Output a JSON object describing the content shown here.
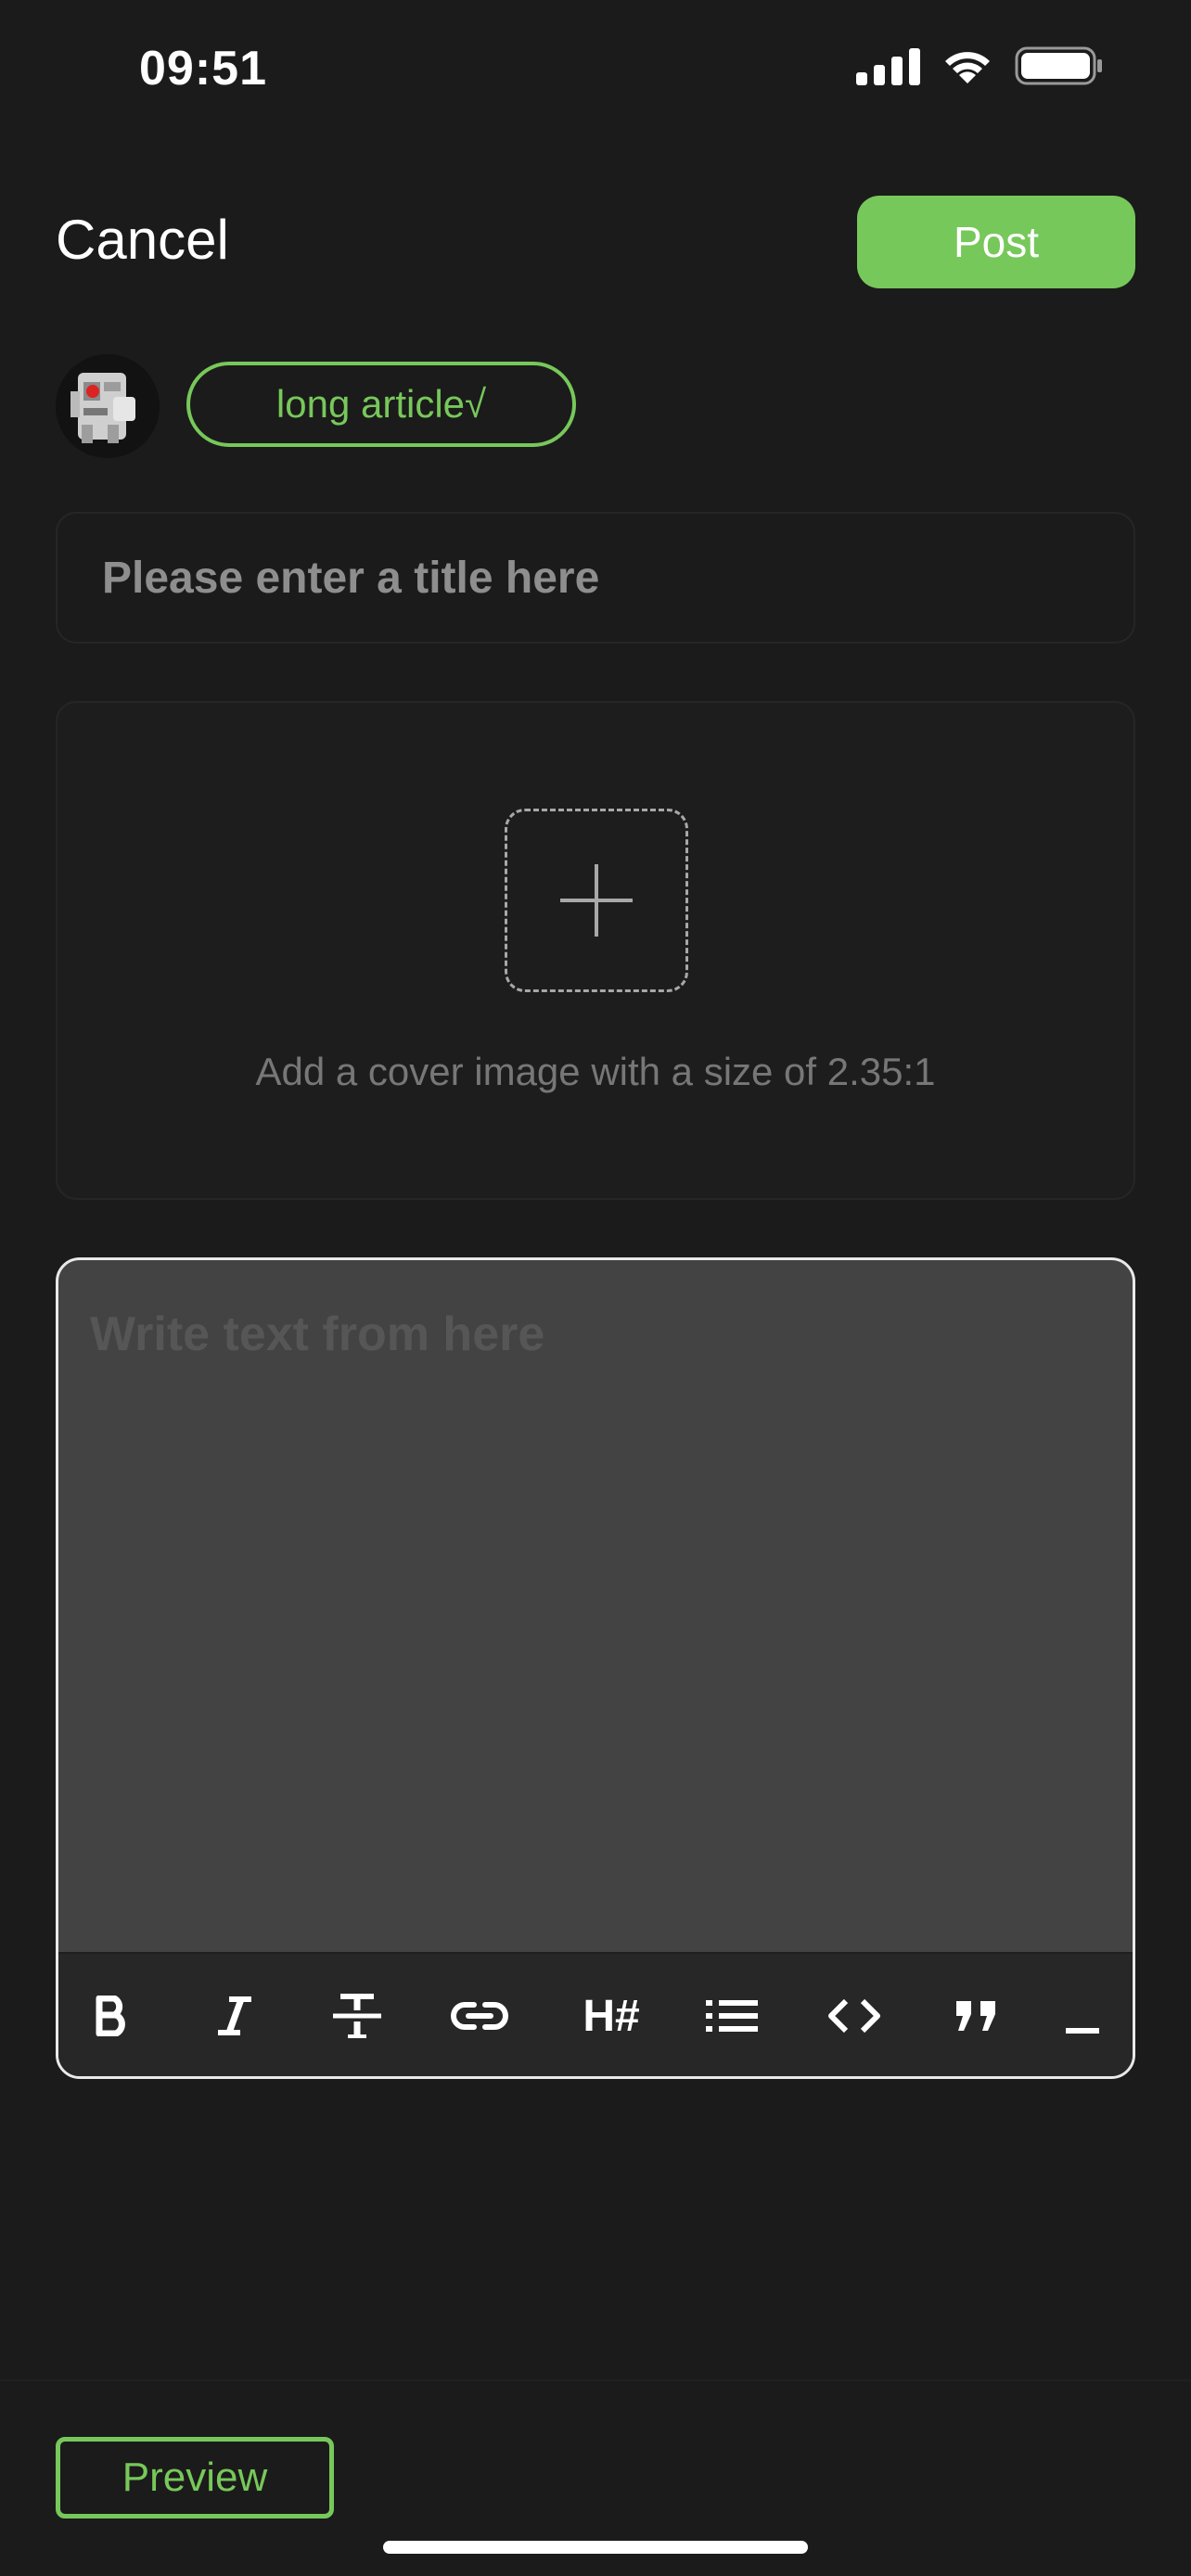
{
  "status_bar": {
    "time": "09:51",
    "icons": [
      "signal-icon",
      "wifi-icon",
      "battery-icon"
    ]
  },
  "header": {
    "cancel_label": "Cancel",
    "post_label": "Post"
  },
  "author": {
    "tag_label": "long article√"
  },
  "title_field": {
    "placeholder": "Please enter a title here"
  },
  "cover": {
    "hint": "Add a cover image with a size of 2.35:1",
    "icon": "plus-icon"
  },
  "editor": {
    "placeholder": "Write text from here",
    "toolbar": [
      {
        "name": "bold",
        "icon": "bold-icon"
      },
      {
        "name": "italic",
        "icon": "italic-icon"
      },
      {
        "name": "strikethrough",
        "icon": "strikethrough-icon"
      },
      {
        "name": "link",
        "icon": "link-icon"
      },
      {
        "name": "heading",
        "label": "H#"
      },
      {
        "name": "list",
        "icon": "list-icon"
      },
      {
        "name": "code",
        "icon": "code-icon"
      },
      {
        "name": "quote",
        "icon": "quote-icon"
      },
      {
        "name": "horizontal-rule",
        "icon": "horizontal-rule-icon"
      }
    ]
  },
  "footer": {
    "preview_label": "Preview"
  },
  "colors": {
    "background": "#1b1b1b",
    "accent": "#77c85a",
    "editor_bg": "#434343",
    "toolbar_bg": "#272727"
  }
}
